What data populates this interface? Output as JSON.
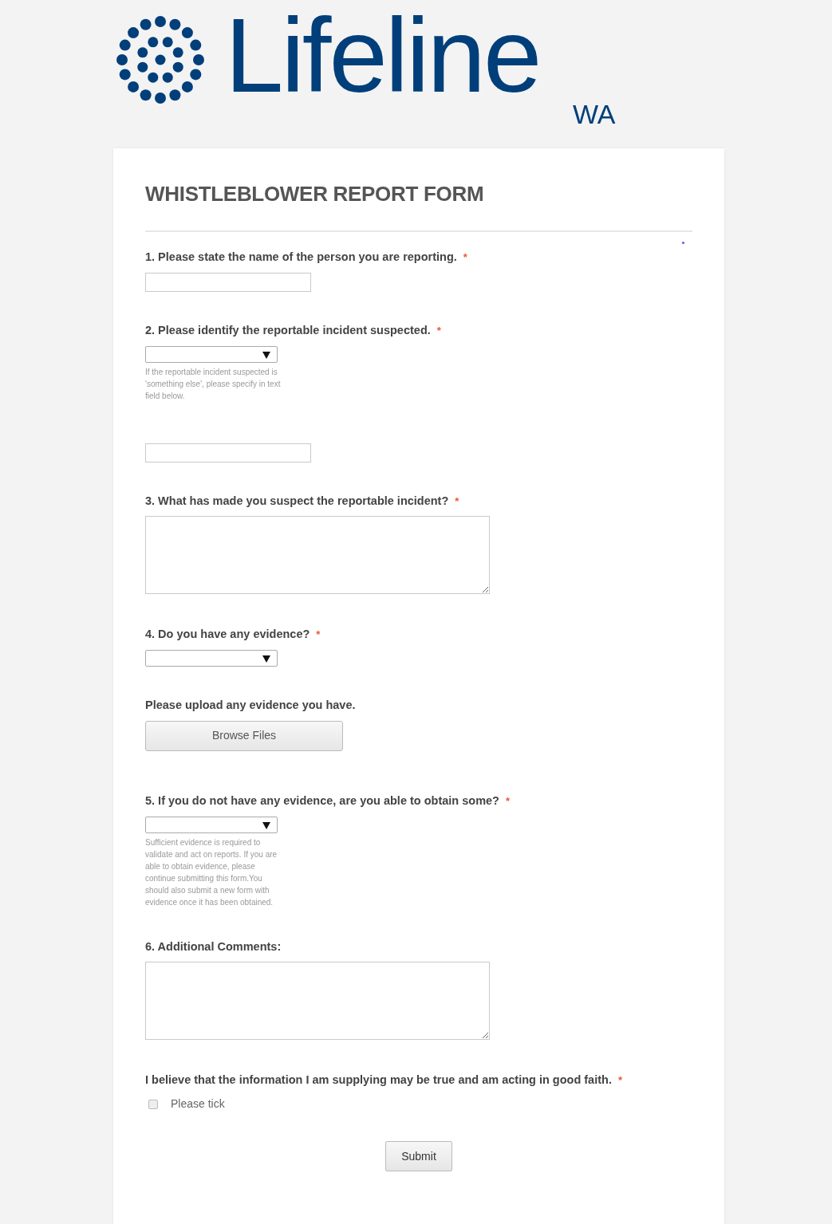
{
  "logo": {
    "name": "Lifeline",
    "region": "WA"
  },
  "form": {
    "title": "WHISTLEBLOWER REPORT FORM",
    "fields": [
      {
        "kind": "text",
        "label": "1. Please state the name of the person you are reporting.",
        "required_mark": "*"
      },
      {
        "kind": "select",
        "label": "2. Please identify the reportable incident suspected.",
        "required_mark": "*",
        "help": "If the reportable incident suspected is 'something else', please specify in text field below."
      },
      {
        "kind": "text"
      },
      {
        "kind": "textarea",
        "label": "3. What has made you suspect the reportable incident?",
        "required_mark": "*"
      },
      {
        "kind": "select",
        "label": "4. Do you have any evidence?",
        "required_mark": "*"
      },
      {
        "kind": "upload",
        "label": "Please upload any evidence you have.",
        "button": "Browse Files"
      },
      {
        "kind": "select",
        "label": "5. If you do not have any evidence, are you able to obtain some?",
        "required_mark": "*",
        "help": "Sufficient evidence is required to validate and act on reports. If you are able to obtain evidence, please continue submitting this form.You should also submit a new form with evidence once it has been obtained."
      },
      {
        "kind": "textarea",
        "label": "6. Additional Comments:"
      },
      {
        "kind": "checkbox",
        "label": "I believe that the information I am supplying may be true and am acting in good faith.",
        "required_mark": "*",
        "option": "Please tick",
        "checked": false
      }
    ],
    "submit": "Submit"
  }
}
